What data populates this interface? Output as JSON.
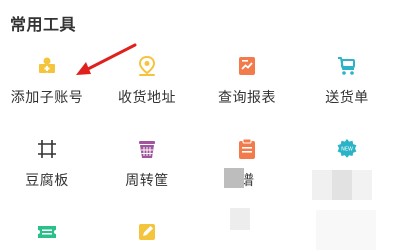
{
  "section": {
    "title": "常用工具"
  },
  "tools": [
    {
      "label": "添加子账号",
      "icon": "add-sub-account-icon",
      "color": "#f5c43d"
    },
    {
      "label": "收货地址",
      "icon": "location-pin-icon",
      "color": "#f5c43d"
    },
    {
      "label": "查询报表",
      "icon": "report-chart-icon",
      "color": "#f37a4a"
    },
    {
      "label": "送货单",
      "icon": "delivery-cart-icon",
      "color": "#2bb3c7"
    },
    {
      "label": "豆腐板",
      "icon": "tofu-board-icon",
      "color": "#333333"
    },
    {
      "label": "周转筐",
      "icon": "turnover-basket-icon",
      "color": "#a0559e"
    },
    {
      "label": "菜谱",
      "icon": "recipe-clipboard-icon",
      "color": "#f37a4a"
    },
    {
      "label": "",
      "icon": "new-badge-icon",
      "color": "#2bb3c7"
    },
    {
      "label": "",
      "icon": "ticket-icon",
      "color": "#2bbf8a"
    },
    {
      "label": "",
      "icon": "edit-note-icon",
      "color": "#f5c43d"
    }
  ],
  "annotation": {
    "arrow_color": "#e0201c"
  }
}
